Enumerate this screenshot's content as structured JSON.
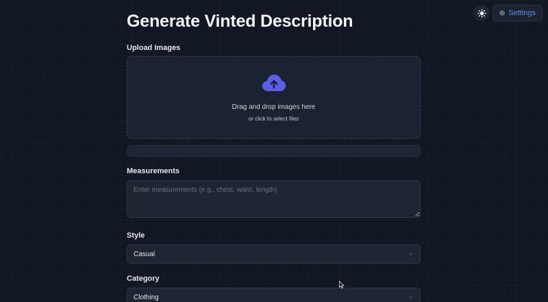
{
  "header": {
    "title": "Generate Vinted Description",
    "settings_label": "Settings"
  },
  "upload": {
    "label": "Upload Images",
    "dropzone_title": "Drag and drop images here",
    "dropzone_subtitle": "or click to select files"
  },
  "measurements": {
    "label": "Measurements",
    "placeholder": "Enter measurements (e.g., chest, waist, length)",
    "value": ""
  },
  "style": {
    "label": "Style",
    "selected": "Casual"
  },
  "category": {
    "label": "Category",
    "selected": "Clothing"
  },
  "colors": {
    "accent": "#5b5fe8",
    "link": "#5b8cf0"
  },
  "icons": {
    "theme": "sun-icon",
    "settings": "gear-icon",
    "upload": "cloud-upload-icon",
    "select": "chevron-down-icon"
  }
}
